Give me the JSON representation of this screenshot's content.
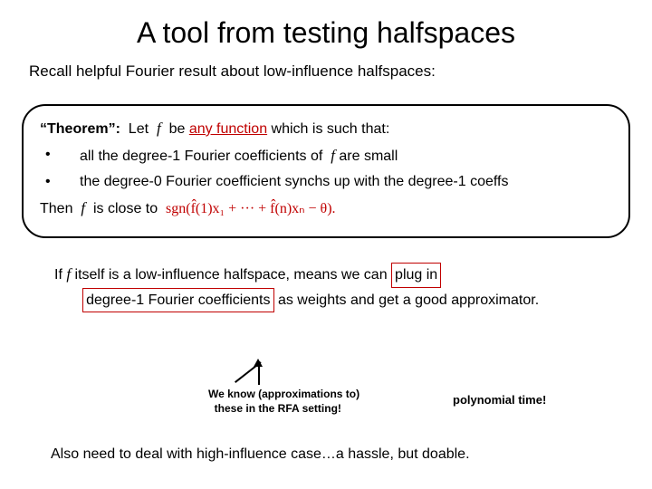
{
  "title": "A tool from testing halfspaces",
  "recall": "Recall helpful Fourier result about low-influence halfspaces:",
  "theorem": {
    "label": "“Theorem”:",
    "let": "Let",
    "f1": "f",
    "be_any": "be",
    "any_function": "any function",
    "which": "which is such that:",
    "bullet1_a": "all the degree-1 Fourier coefficients of",
    "bullet1_f": "f",
    "bullet1_b": "are small",
    "bullet2": "the degree-0 Fourier coefficient synchs up with the degree-1 coeffs",
    "then": "Then",
    "f2": "f",
    "close": "is close to",
    "formula": "sgn(f̂(1)x₁ + ··· + f̂(n)xₙ − θ).",
    "period": "."
  },
  "cond": {
    "if": "If",
    "f": "f",
    "itself": "itself is a low-influence halfspace, means we can",
    "plug": "plug in",
    "d1": "degree-1 Fourier coefficients",
    "tail": "as weights and get a good approximator."
  },
  "note_rfa_1": "We know (approximations to)",
  "note_rfa_2": "these in the RFA setting!",
  "note_poly": "polynomial time!",
  "also": "Also need to deal with high-influence case…a hassle, but doable."
}
